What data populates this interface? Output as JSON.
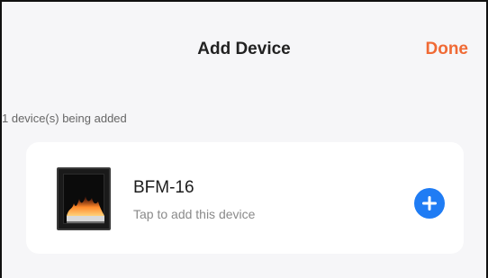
{
  "header": {
    "title": "Add Device",
    "done_label": "Done"
  },
  "section": {
    "label": "1 device(s) being added"
  },
  "device": {
    "name": "BFM-16",
    "subtitle": "Tap to add this device",
    "thumbnail_icon": "electric-fireplace-image",
    "add_icon": "plus-circle-icon"
  },
  "colors": {
    "accent_done": "#f06a35",
    "add_button": "#1f7cf4",
    "background": "#f6f6f8",
    "card": "#ffffff"
  }
}
